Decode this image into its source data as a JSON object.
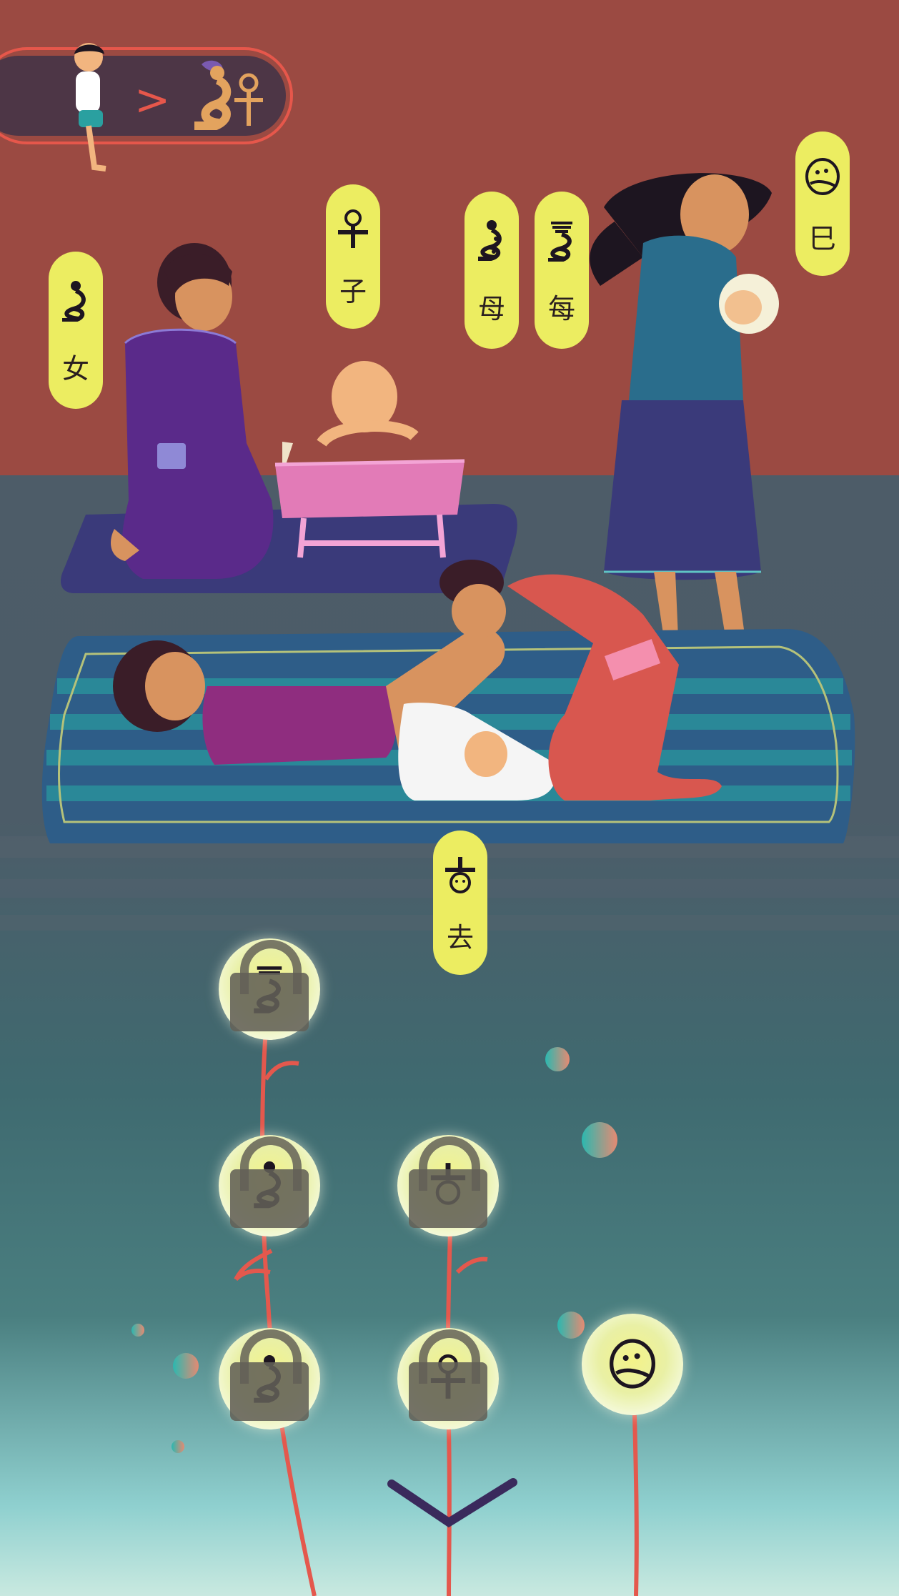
{
  "tags": [
    {
      "id": "nu",
      "char": "女"
    },
    {
      "id": "zi",
      "char": "子"
    },
    {
      "id": "mu",
      "char": "母"
    },
    {
      "id": "mei",
      "char": "每"
    },
    {
      "id": "si",
      "char": "巳"
    },
    {
      "id": "qu",
      "char": "去"
    }
  ],
  "breadcrumb": {
    "separator": ">"
  },
  "orbs": [
    {
      "glyph": "mei-glyph",
      "locked": true
    },
    {
      "glyph": "mu-glyph",
      "locked": true
    },
    {
      "glyph": "qu-glyph",
      "locked": true
    },
    {
      "glyph": "nu-glyph",
      "locked": true
    },
    {
      "glyph": "zi-glyph",
      "locked": true
    },
    {
      "glyph": "si-glyph",
      "locked": false
    }
  ],
  "colors": {
    "wall": "#9b4a42",
    "floor": "#4d5c68",
    "tag": "#eced61",
    "accent": "#e6574b",
    "scroll": "#3a2a5c"
  }
}
